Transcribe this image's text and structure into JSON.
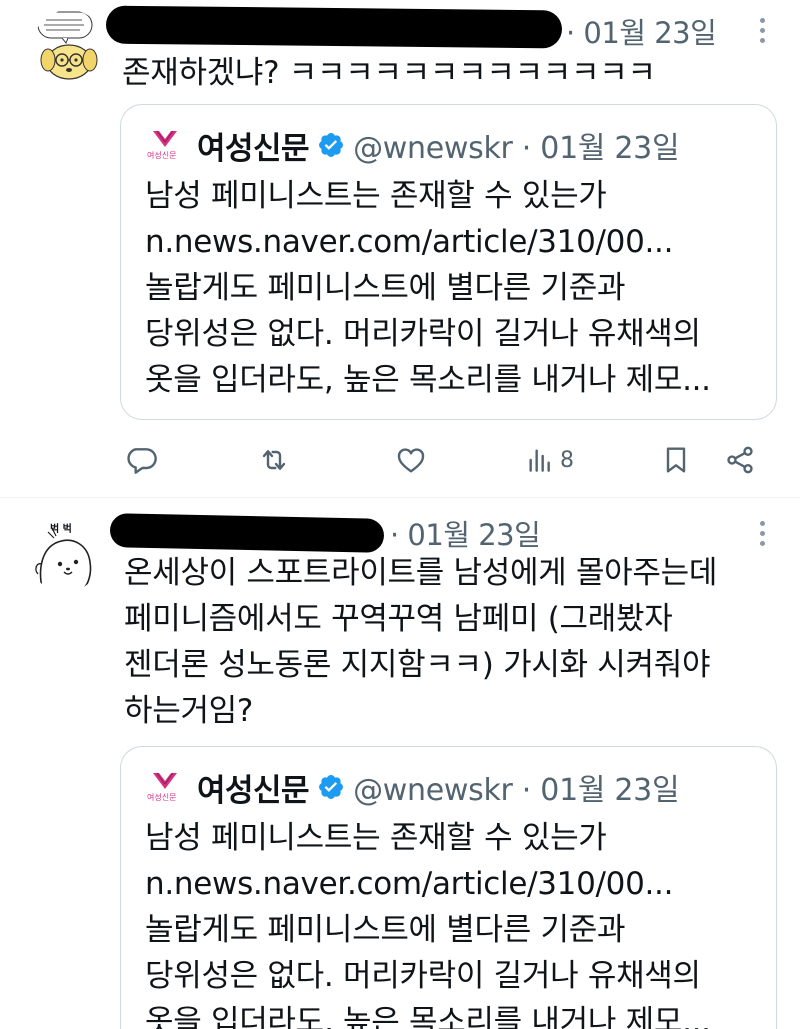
{
  "colors": {
    "accent": "#1d9bf0",
    "secondary_text": "#536471",
    "border": "#cfd9de",
    "redaction": "#000000",
    "logo_pink": "#d6307f"
  },
  "tweets": [
    {
      "timestamp": "· 01월 23일",
      "text_lines": [
        "존재하겠냐? ㅋㅋㅋㅋㅋㅋㅋㅋㅋㅋㅋㅋㅋ"
      ],
      "quote": {
        "logo_text": "여성신문",
        "name": "여성신문",
        "handle_time": "@wnewskr · 01월 23일",
        "lines": [
          "남성 페미니스트는 존재할 수 있는가",
          "n.news.naver.com/article/310/00...",
          "놀랍게도 페미니스트에 별다른 기준과",
          "당위성은 없다. 머리카락이 길거나 유채색의",
          "옷을 입더라도, 높은 목소리를 내거나 제모..."
        ]
      },
      "actions": {
        "reply_icon": "reply-icon",
        "retweet_icon": "retweet-icon",
        "like_icon": "heart-icon",
        "views_icon": "views-icon",
        "views_count": "8",
        "bookmark_icon": "bookmark-icon",
        "share_icon": "share-icon"
      }
    },
    {
      "timestamp": "· 01월 23일",
      "avatar_text": "벅 벅",
      "text_lines": [
        "온세상이 스포트라이트를 남성에게 몰아주는데",
        "페미니즘에서도 꾸역꾸역 남페미 (그래봤자",
        "젠더론 성노동론 지지함ㅋㅋ) 가시화 시켜줘야",
        "하는거임?"
      ],
      "quote": {
        "logo_text": "여성신문",
        "name": "여성신문",
        "handle_time": "@wnewskr · 01월 23일",
        "lines": [
          "남성 페미니스트는 존재할 수 있는가",
          "n.news.naver.com/article/310/00...",
          "놀랍게도 페미니스트에 별다른 기준과",
          "당위성은 없다. 머리카락이 길거나 유채색의",
          "옷을 입더라도, 높은 목소리를 내거나 제모..."
        ]
      }
    }
  ]
}
